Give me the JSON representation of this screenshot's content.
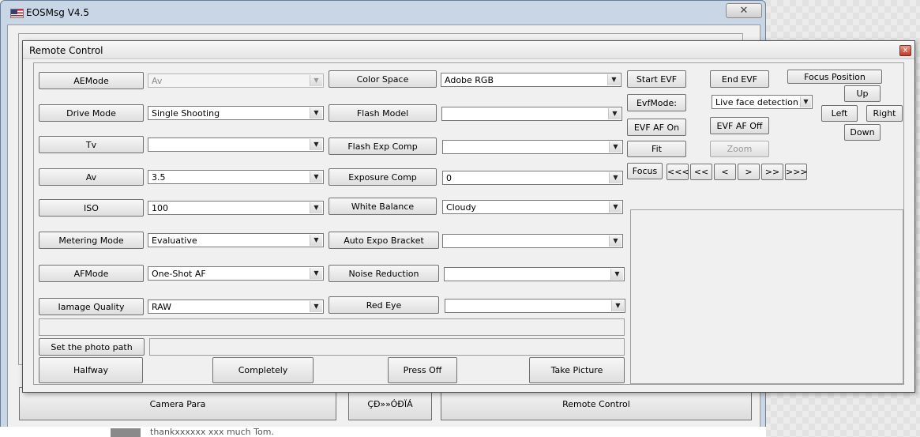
{
  "main_window": {
    "title": "EOSMsg V4.5",
    "close_glyph": "✕",
    "bottom_buttons": [
      "Camera Para",
      "ÇĐ»»ÓĐÏÁ",
      "Remote Control"
    ],
    "behind_text": "thankxxxxxx xxx much Tom."
  },
  "remote_control": {
    "title": "Remote Control",
    "close_glyph": "x",
    "left_rows": [
      {
        "label": "AEMode",
        "value": "Av",
        "disabled": true
      },
      {
        "label": "Drive Mode",
        "value": "Single Shooting"
      },
      {
        "label": "Tv",
        "value": ""
      },
      {
        "label": "Av",
        "value": "3.5"
      },
      {
        "label": "ISO",
        "value": "100"
      },
      {
        "label": "Metering Mode",
        "value": "Evaluative"
      },
      {
        "label": "AFMode",
        "value": "One-Shot AF"
      },
      {
        "label": "Iamage Quality",
        "value": "RAW"
      }
    ],
    "mid_rows": [
      {
        "label": "Color Space",
        "value": "Adobe RGB"
      },
      {
        "label": "Flash Model",
        "value": ""
      },
      {
        "label": "Flash Exp Comp",
        "value": ""
      },
      {
        "label": "Exposure Comp",
        "value": "0"
      },
      {
        "label": "White Balance",
        "value": "Cloudy"
      },
      {
        "label": "Auto Expo Bracket",
        "value": ""
      },
      {
        "label": "Noise Reduction",
        "value": ""
      },
      {
        "label": "Red Eye",
        "value": ""
      }
    ],
    "photo_path_button": "Set the photo path",
    "photo_path_value": "",
    "bottom_buttons": {
      "halfway": "Halfway",
      "completely": "Completely",
      "press_off": "Press Off",
      "take_picture": "Take Picture"
    },
    "evf": {
      "start": "Start EVF",
      "end": "End EVF",
      "mode_label": "EvfMode:",
      "mode_value": "Live face detection mo",
      "af_on": "EVF AF On",
      "af_off": "EVF AF Off",
      "fit": "Fit",
      "zoom": "Zoom",
      "focus": "Focus",
      "focus_steps": [
        "<<<",
        "<<",
        "<",
        ">",
        ">>",
        ">>>"
      ]
    },
    "focus_position": {
      "title": "Focus Position",
      "up": "Up",
      "left": "Left",
      "right": "Right",
      "down": "Down"
    },
    "arrow_glyph": "▼"
  }
}
